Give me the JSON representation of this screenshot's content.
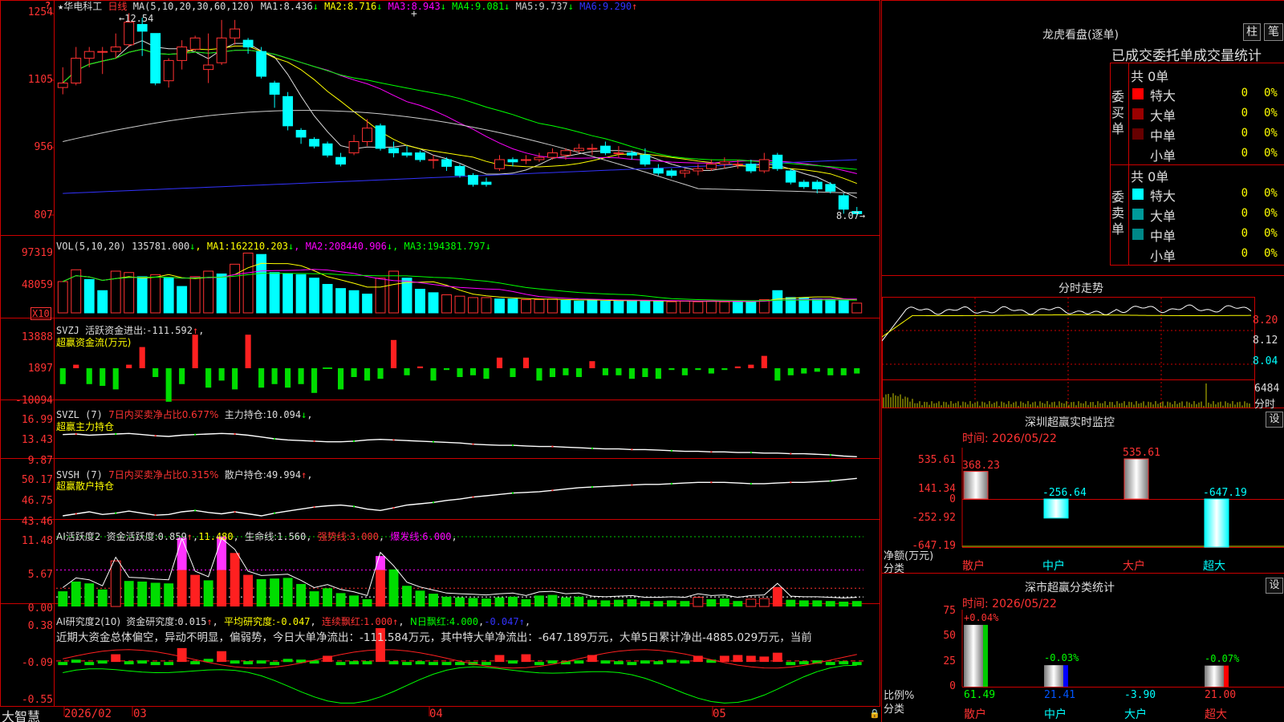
{
  "main": {
    "stock_name": "华电科工",
    "period": "日线",
    "ma_label": "MA(5,10,20,30,60,120)",
    "ma": [
      {
        "name": "MA1:",
        "value": "8.436",
        "arrow": "↓",
        "color": "#dddddd"
      },
      {
        "name": "MA2:",
        "value": "8.716",
        "arrow": "↓",
        "color": "#ffff00"
      },
      {
        "name": "MA3:",
        "value": "8.943",
        "arrow": "↓",
        "color": "#ff00ff"
      },
      {
        "name": "MA4:",
        "value": "9.081",
        "arrow": "↓",
        "color": "#00ff00"
      },
      {
        "name": "MA5:",
        "value": "9.737",
        "arrow": "↓",
        "color": "#cccccc"
      },
      {
        "name": "MA6:",
        "value": "9.290",
        "arrow": "↑",
        "color": "#3333ff"
      }
    ],
    "y_axis": [
      "1254",
      "1105",
      "956",
      "807"
    ],
    "high_label": "12.54",
    "low_label": "8.07",
    "candles": [
      [
        10.9,
        11.0,
        11.35,
        10.75
      ],
      [
        11.0,
        11.55,
        11.8,
        10.95
      ],
      [
        11.55,
        11.7,
        11.8,
        11.35
      ],
      [
        11.7,
        11.7,
        11.8,
        11.2
      ],
      [
        11.7,
        11.8,
        12.1,
        11.55
      ],
      [
        11.85,
        12.35,
        12.55,
        11.8
      ],
      [
        12.3,
        12.15,
        12.45,
        11.6
      ],
      [
        12.1,
        11.0,
        12.1,
        10.95
      ],
      [
        11.05,
        11.5,
        11.55,
        10.9
      ],
      [
        11.5,
        11.8,
        11.95,
        11.3
      ],
      [
        11.75,
        12.0,
        12.05,
        11.7
      ],
      [
        11.3,
        11.4,
        12.1,
        11.0
      ],
      [
        11.45,
        12.0,
        12.4,
        11.4
      ],
      [
        12.0,
        12.2,
        12.4,
        11.85
      ],
      [
        11.95,
        11.8,
        12.0,
        11.65
      ],
      [
        11.7,
        11.15,
        11.8,
        11.1
      ],
      [
        11.0,
        10.75,
        11.05,
        10.45
      ],
      [
        10.7,
        10.05,
        10.8,
        9.95
      ],
      [
        9.95,
        9.8,
        10.0,
        9.65
      ],
      [
        9.75,
        9.6,
        9.8,
        9.55
      ],
      [
        9.65,
        9.4,
        9.7,
        9.35
      ],
      [
        9.35,
        9.2,
        9.45,
        9.15
      ],
      [
        9.45,
        9.7,
        9.85,
        9.4
      ],
      [
        9.7,
        10.0,
        10.2,
        9.6
      ],
      [
        10.05,
        9.55,
        10.1,
        9.5
      ],
      [
        9.55,
        9.45,
        9.7,
        9.35
      ],
      [
        9.45,
        9.4,
        9.6,
        9.35
      ],
      [
        9.45,
        9.3,
        9.5,
        9.25
      ],
      [
        9.3,
        9.3,
        9.4,
        9.1
      ],
      [
        9.3,
        9.15,
        9.35,
        9.05
      ],
      [
        9.15,
        8.95,
        9.2,
        8.9
      ],
      [
        8.95,
        8.75,
        9.0,
        8.7
      ],
      [
        8.8,
        8.75,
        8.9,
        8.7
      ],
      [
        9.1,
        9.3,
        9.4,
        9.05
      ],
      [
        9.3,
        9.25,
        9.35,
        9.15
      ],
      [
        9.3,
        9.3,
        9.4,
        9.2
      ],
      [
        9.3,
        9.35,
        9.45,
        9.25
      ],
      [
        9.35,
        9.45,
        9.55,
        9.3
      ],
      [
        9.4,
        9.5,
        9.55,
        9.3
      ],
      [
        9.5,
        9.55,
        9.65,
        9.45
      ],
      [
        9.55,
        9.55,
        9.65,
        9.4
      ],
      [
        9.6,
        9.45,
        9.7,
        9.4
      ],
      [
        9.45,
        9.45,
        9.6,
        9.35
      ],
      [
        9.45,
        9.4,
        9.5,
        9.3
      ],
      [
        9.4,
        9.2,
        9.55,
        9.15
      ],
      [
        9.1,
        9.0,
        9.2,
        8.95
      ],
      [
        9.05,
        8.95,
        9.1,
        8.9
      ],
      [
        9.0,
        9.05,
        9.1,
        8.9
      ],
      [
        9.05,
        9.1,
        9.2,
        8.95
      ],
      [
        9.1,
        9.2,
        9.3,
        9.05
      ],
      [
        9.2,
        9.25,
        9.35,
        9.1
      ],
      [
        9.2,
        9.2,
        9.3,
        9.1
      ],
      [
        9.2,
        9.05,
        9.3,
        9.0
      ],
      [
        9.05,
        9.3,
        9.45,
        9.0
      ],
      [
        9.4,
        9.1,
        9.45,
        9.05
      ],
      [
        9.05,
        8.8,
        9.1,
        8.75
      ],
      [
        8.8,
        8.7,
        8.85,
        8.65
      ],
      [
        8.8,
        8.65,
        8.85,
        8.55
      ],
      [
        8.75,
        8.6,
        8.8,
        8.55
      ],
      [
        8.5,
        8.2,
        8.55,
        8.1
      ],
      [
        8.15,
        8.1,
        8.25,
        8.07
      ]
    ]
  },
  "vol": {
    "label": "VOL(5,10,20)",
    "value": "135781.000",
    "items": [
      {
        "name": "MA1:",
        "value": "162210.203",
        "arrow": "↓",
        "color": "#ffff00"
      },
      {
        "name": "MA2:",
        "value": "208440.906",
        "arrow": "↓",
        "color": "#ff00ff"
      },
      {
        "name": "MA3:",
        "value": "194381.797",
        "arrow": "↓",
        "color": "#00ff00"
      }
    ],
    "y_axis": [
      "97319",
      "48059"
    ],
    "unit": "X10",
    "values": [
      0.45,
      0.62,
      0.48,
      0.32,
      0.6,
      0.58,
      0.52,
      0.55,
      0.5,
      0.38,
      0.52,
      0.6,
      0.56,
      0.7,
      0.86,
      0.84,
      0.58,
      0.56,
      0.55,
      0.5,
      0.41,
      0.35,
      0.32,
      0.27,
      0.5,
      0.6,
      0.5,
      0.34,
      0.29,
      0.26,
      0.24,
      0.22,
      0.22,
      0.2,
      0.2,
      0.19,
      0.19,
      0.2,
      0.18,
      0.17,
      0.19,
      0.17,
      0.17,
      0.18,
      0.17,
      0.17,
      0.16,
      0.17,
      0.16,
      0.17,
      0.16,
      0.16,
      0.16,
      0.19,
      0.32,
      0.22,
      0.22,
      0.2,
      0.19,
      0.18,
      0.14
    ],
    "up": [
      1,
      1,
      0,
      0,
      1,
      1,
      0,
      1,
      0,
      0,
      1,
      1,
      0,
      1,
      1,
      0,
      0,
      0,
      0,
      0,
      0,
      0,
      0,
      0,
      1,
      1,
      0,
      0,
      0,
      1,
      1,
      1,
      1,
      0,
      0,
      1,
      1,
      1,
      0,
      0,
      0,
      0,
      0,
      0,
      0,
      0,
      1,
      1,
      1,
      1,
      1,
      0,
      0,
      1,
      0,
      0,
      0,
      0,
      0,
      0,
      1
    ]
  },
  "svzj": {
    "name": "SVZJ",
    "title": "活跃资金进出:",
    "value": "-111.592",
    "arrow": "↑",
    "subtitle": "超赢资金流(万元)",
    "y_axis": [
      "13888",
      "1897",
      "-10094"
    ],
    "values": [
      -0.45,
      0.1,
      -0.45,
      -0.5,
      -0.6,
      0.1,
      0.6,
      -0.25,
      -0.95,
      -0.45,
      0.95,
      -0.55,
      -0.35,
      -0.6,
      0.95,
      -0.55,
      -0.45,
      -0.55,
      -0.45,
      -0.7,
      0.0,
      -0.6,
      -0.25,
      -0.35,
      -0.3,
      0.8,
      -0.2,
      0.05,
      -0.35,
      -0.05,
      -0.25,
      -0.2,
      -0.3,
      0.3,
      -0.25,
      0.3,
      -0.35,
      -0.25,
      -0.2,
      -0.25,
      0.2,
      -0.2,
      -0.2,
      -0.3,
      -0.25,
      -0.3,
      -0.05,
      -0.2,
      -0.05,
      -0.15,
      -0.05,
      0.05,
      0.1,
      0.35,
      -0.35,
      -0.2,
      -0.15,
      -0.1,
      -0.2,
      -0.2,
      -0.15
    ]
  },
  "svzl": {
    "name": "SVZL",
    "period": "(7)",
    "desc": "7日内买卖净占比0.677%",
    "label": "主力持仓:",
    "value": "10.094",
    "arrow": "↓",
    "subtitle": "超赢主力持仓",
    "y_axis": [
      "16.99",
      "13.43",
      "9.87"
    ],
    "values": [
      13.8,
      13.9,
      13.7,
      13.8,
      13.9,
      14.0,
      13.8,
      13.6,
      13.5,
      13.7,
      13.8,
      13.9,
      14.0,
      13.9,
      13.7,
      13.4,
      13.1,
      12.9,
      12.8,
      12.7,
      12.6,
      12.6,
      12.7,
      12.9,
      13.0,
      12.9,
      12.8,
      12.7,
      12.6,
      12.5,
      12.4,
      12.2,
      12.1,
      12.0,
      12.0,
      11.9,
      11.8,
      11.8,
      11.7,
      11.6,
      11.5,
      11.4,
      11.4,
      11.3,
      11.3,
      11.2,
      11.1,
      11.0,
      11.0,
      10.9,
      10.9,
      10.8,
      10.8,
      10.7,
      10.7,
      10.6,
      10.6,
      10.5,
      10.4,
      10.2,
      10.1
    ]
  },
  "svsh": {
    "name": "SVSH",
    "period": "(7)",
    "desc": "7日内买卖净占比0.315%",
    "label": "散户持仓:",
    "value": "49.994",
    "arrow": "↑",
    "subtitle": "超赢散户持仓",
    "y_axis": [
      "50.17",
      "46.75",
      "43.46"
    ],
    "values": [
      44.3,
      44.6,
      44.9,
      44.5,
      44.7,
      45.0,
      44.7,
      44.4,
      44.5,
      44.9,
      45.1,
      44.8,
      44.6,
      44.9,
      44.6,
      44.3,
      44.7,
      45.0,
      45.3,
      45.6,
      45.8,
      45.9,
      45.7,
      45.3,
      45.1,
      45.5,
      45.9,
      46.1,
      46.3,
      46.6,
      46.8,
      47.1,
      47.3,
      47.5,
      47.7,
      47.8,
      47.9,
      48.1,
      48.3,
      48.5,
      48.6,
      48.7,
      48.8,
      48.9,
      49.0,
      49.0,
      49.1,
      49.2,
      49.3,
      49.3,
      49.3,
      49.2,
      49.1,
      49.1,
      49.2,
      49.3,
      49.3,
      49.4,
      49.5,
      49.7,
      49.9
    ]
  },
  "ai_act": {
    "name": "AI活跃度2",
    "label": "资金活跃度:",
    "value": "0.859",
    "v2": "11.480",
    "life_label": "生命线:",
    "life_value": "1.560",
    "strong_label": "强势线:",
    "strong_value": "3.000",
    "burst_label": "爆发线:",
    "burst_value": "6.000",
    "y_axis": [
      "11.48",
      "5.67",
      "0.00"
    ],
    "values": [
      2.5,
      4.1,
      3.8,
      2.8,
      7.5,
      4.2,
      4.1,
      3.9,
      3.8,
      11.3,
      5.2,
      4.3,
      11.5,
      8.8,
      5.2,
      4.5,
      4.6,
      4.7,
      3.7,
      2.5,
      3.0,
      2.2,
      1.8,
      1.2,
      8.3,
      6.1,
      3.4,
      2.6,
      2.1,
      1.6,
      1.5,
      1.4,
      1.3,
      1.5,
      1.6,
      1.2,
      1.8,
      1.9,
      1.5,
      1.6,
      1.1,
      1.0,
      1.1,
      1.2,
      0.9,
      0.9,
      1.0,
      0.9,
      1.5,
      1.2,
      1.3,
      0.9,
      1.2,
      1.3,
      3.2,
      1.1,
      1.0,
      1.0,
      0.9,
      0.8,
      0.9
    ],
    "kind": [
      0,
      0,
      0,
      0,
      3,
      0,
      0,
      0,
      0,
      2,
      1,
      0,
      2,
      1,
      1,
      0,
      0,
      0,
      0,
      0,
      0,
      0,
      0,
      0,
      2,
      0,
      0,
      0,
      0,
      0,
      0,
      0,
      0,
      0,
      0,
      0,
      0,
      0,
      0,
      0,
      0,
      0,
      0,
      0,
      0,
      0,
      0,
      0,
      3,
      0,
      0,
      0,
      3,
      3,
      1,
      0,
      0,
      0,
      0,
      0,
      0
    ]
  },
  "ai_res": {
    "name": "AI研究度2(10)",
    "label": "资金研究度:",
    "value": "0.015",
    "avg_label": "平均研究度:",
    "avg_value": "-0.047",
    "lian_label": "连续飘红:",
    "lian_value": "1.000",
    "n_label": "N日飘红:",
    "n_value": "4.000",
    "extra": "-0.047",
    "comment": "近期大资金总体偏空，异动不明显，偏弱势，今日大单净流出：-111.584万元，其中特大单净流出：-647.189万元，大单5日累计净出-4885.029万元，当前",
    "y_axis": [
      "0.38",
      "-0.09",
      "-0.55"
    ],
    "values": [
      -0.1,
      -0.03,
      -0.08,
      -0.04,
      0.04,
      -0.05,
      -0.04,
      -0.06,
      -0.08,
      0.12,
      -0.05,
      -0.02,
      0.08,
      -0.04,
      -0.05,
      -0.04,
      -0.06,
      -0.02,
      -0.03,
      -0.04,
      0.02,
      -0.06,
      -0.05,
      -0.05,
      0.38,
      -0.05,
      -0.06,
      -0.05,
      -0.07,
      -0.09,
      -0.1,
      -0.09,
      -0.07,
      0.03,
      -0.04,
      0.04,
      -0.06,
      -0.04,
      -0.05,
      -0.04,
      0.03,
      -0.04,
      -0.05,
      -0.06,
      -0.04,
      -0.05,
      -0.03,
      -0.04,
      0.02,
      -0.03,
      0.02,
      0.03,
      0.02,
      0.01,
      0.06,
      -0.06,
      -0.05,
      -0.04,
      -0.06,
      -0.05,
      -0.06
    ]
  },
  "x_axis": {
    "labels": [
      "2026/02",
      "03",
      "04",
      "05"
    ]
  },
  "logo": "大智慧",
  "dragon": {
    "title": "龙虎看盘(逐单)",
    "btn_zhu": "柱",
    "btn_bi": "笔",
    "headline": "已成交委托单成交量统计",
    "buy_label": "委买单",
    "sell_label": "委卖单",
    "buy_total": "共 0单",
    "sell_total": "共 0单",
    "buy_rows": [
      {
        "name": "特大",
        "count": "0",
        "pct": "0%",
        "color": "#ff0000"
      },
      {
        "name": "大单",
        "count": "0",
        "pct": "0%",
        "color": "#990000"
      },
      {
        "name": "中单",
        "count": "0",
        "pct": "0%",
        "color": "#660000"
      },
      {
        "name": "小单",
        "count": "0",
        "pct": "0%",
        "color": "#000000"
      }
    ],
    "sell_rows": [
      {
        "name": "特大",
        "count": "0",
        "pct": "0%",
        "color": "#00ffff"
      },
      {
        "name": "大单",
        "count": "0",
        "pct": "0%",
        "color": "#009999"
      },
      {
        "name": "中单",
        "count": "0",
        "pct": "0%",
        "color": "#008888"
      },
      {
        "name": "小单",
        "count": "0",
        "pct": "0%",
        "color": "#000000"
      }
    ]
  },
  "intraday": {
    "title": "分时走势",
    "y_axis": [
      "8.20",
      "8.12",
      "8.04"
    ],
    "vol_label": "6484",
    "vol_unit": "分时"
  },
  "sz_monitor": {
    "title": "深圳超赢实时监控",
    "set": "设",
    "time_label": "时间: 2026/05/22",
    "y_axis": [
      "535.61",
      "141.34",
      "0",
      "-252.92",
      "-647.19"
    ],
    "bars": [
      {
        "cat": "散户",
        "value": 368.23,
        "label": "368.23"
      },
      {
        "cat": "中户",
        "value": -256.64,
        "label": "-256.64"
      },
      {
        "cat": "大户",
        "value": 535.61,
        "label": "535.61"
      },
      {
        "cat": "超大",
        "value": -647.19,
        "label": "-647.19"
      }
    ],
    "unit_label": "净额(万元)",
    "class_label": "分类"
  },
  "sz_stats": {
    "title": "深市超赢分类统计",
    "set": "设",
    "time_label": "时间: 2026/05/22",
    "y_axis": [
      "75",
      "50",
      "25",
      "0"
    ],
    "bars": [
      {
        "cat": "散户",
        "value": 61.49,
        "label": "61.49",
        "top": "+0.04%",
        "color": "#00cc00"
      },
      {
        "cat": "中户",
        "value": 21.41,
        "label": "21.41",
        "top": "-0.03%",
        "color": "#0000ff"
      },
      {
        "cat": "大户",
        "value": -3.9,
        "label": "-3.90",
        "top": "",
        "color": "#000000"
      },
      {
        "cat": "超大",
        "value": 21.0,
        "label": "21.00",
        "top": "-0.07%",
        "color": "#ff0000"
      }
    ],
    "unit_label": "比例%",
    "class_label": "分类"
  }
}
